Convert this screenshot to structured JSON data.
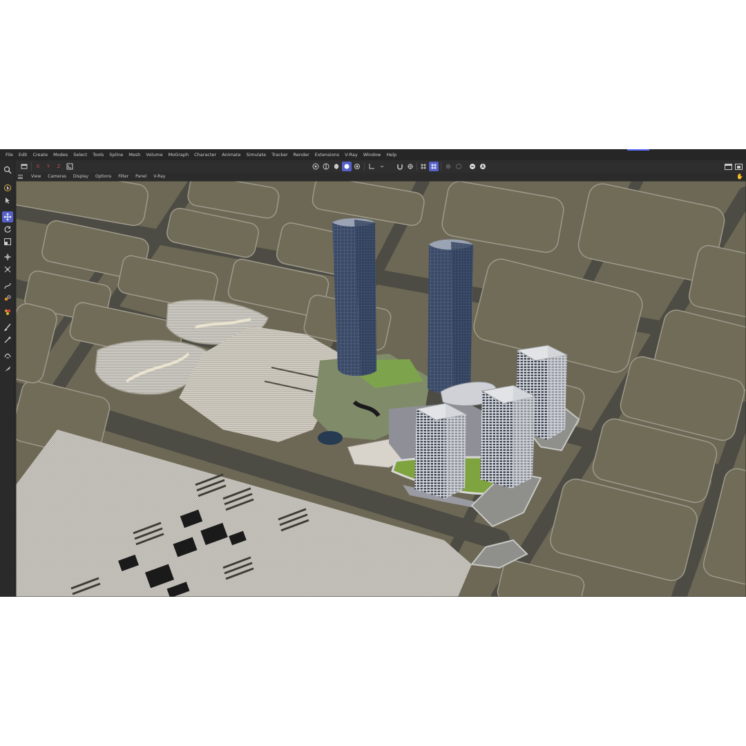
{
  "menubar": {
    "items": [
      "File",
      "Edit",
      "Create",
      "Modes",
      "Select",
      "Tools",
      "Spline",
      "Mesh",
      "Volume",
      "MoGraph",
      "Character",
      "Animate",
      "Simulate",
      "Tracker",
      "Render",
      "Extensions",
      "V-Ray",
      "Window",
      "Help"
    ]
  },
  "toolbar": {
    "axis_x": "X",
    "axis_y": "Y",
    "axis_z": "Z"
  },
  "viewport_menu": {
    "items": [
      "View",
      "Cameras",
      "Display",
      "Options",
      "Filter",
      "Panel",
      "V-Ray"
    ]
  },
  "left_tools": [
    "search-icon",
    "live-select-icon",
    "move-icon",
    "rotate-icon",
    "scale-icon",
    "transform-icon",
    "coordinate-icon",
    "spline-pen-icon",
    "material-icon",
    "paint-icon",
    "brush-icon",
    "sketch-icon"
  ],
  "colors": {
    "accent": "#5561c9",
    "ground": "#6e6a58",
    "road": "#4a4a42",
    "tower_glass": "#3b4a63"
  }
}
